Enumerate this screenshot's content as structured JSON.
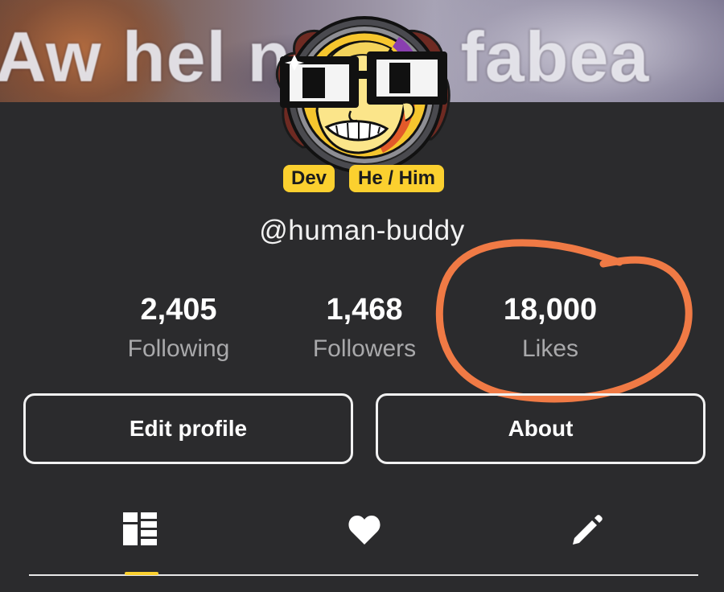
{
  "banner": {
    "caption": "Aw hel n     ddy fabea"
  },
  "profile": {
    "badges": [
      "Dev",
      "He / Him"
    ],
    "handle": "@human-buddy"
  },
  "stats": [
    {
      "value": "2,405",
      "label": "Following"
    },
    {
      "value": "1,468",
      "label": "Followers"
    },
    {
      "value": "18,000",
      "label": "Likes"
    }
  ],
  "actions": {
    "edit_label": "Edit profile",
    "about_label": "About"
  },
  "tabs": [
    {
      "icon": "grid-layout-icon",
      "selected": true
    },
    {
      "icon": "heart-icon",
      "selected": false
    },
    {
      "icon": "pencil-icon",
      "selected": false
    }
  ],
  "colors": {
    "background": "#2b2b2d",
    "accent": "#fbd02f",
    "annotation": "#f07a45",
    "text_primary": "#ffffff",
    "text_secondary": "#a9a9ab"
  }
}
